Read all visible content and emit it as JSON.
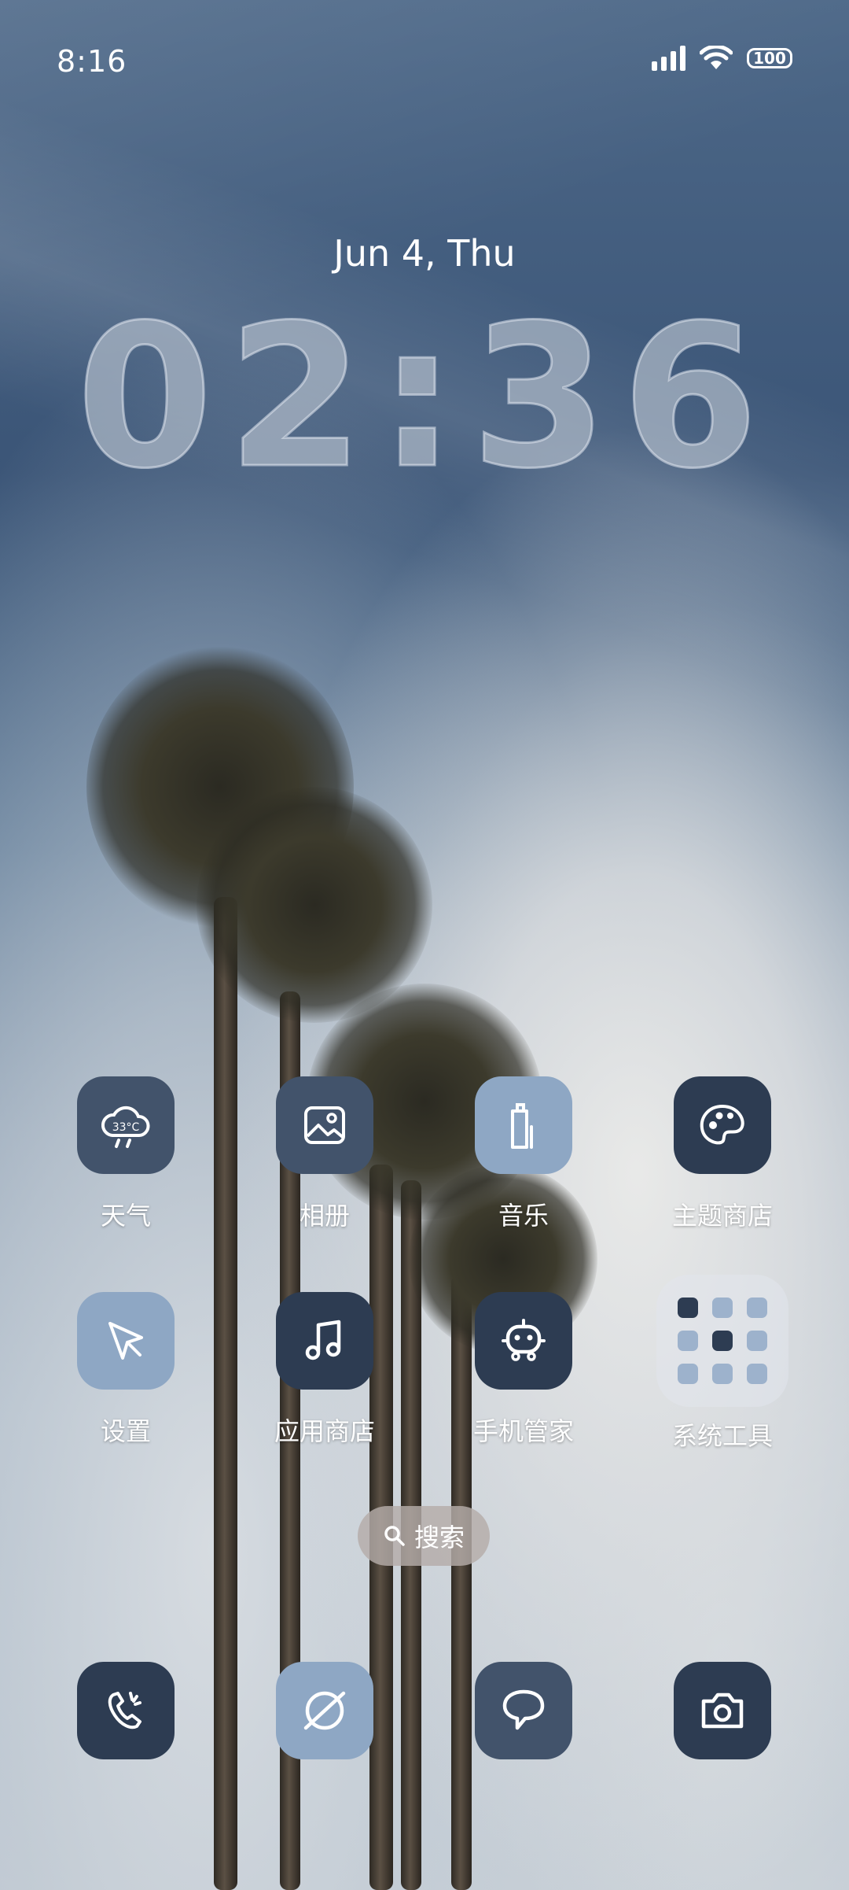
{
  "status_bar": {
    "time": "8:16",
    "battery": "100"
  },
  "lockclock": {
    "date": "Jun 4, Thu",
    "time": "02:36"
  },
  "weather_temp": "33°C",
  "apps_row1": [
    {
      "label": "天气",
      "icon": "weather-icon"
    },
    {
      "label": "相册",
      "icon": "gallery-icon"
    },
    {
      "label": "音乐",
      "icon": "music-bag-icon"
    },
    {
      "label": "主题商店",
      "icon": "palette-icon"
    }
  ],
  "apps_row2": [
    {
      "label": "设置",
      "icon": "cursor-icon"
    },
    {
      "label": "应用商店",
      "icon": "music-note-icon"
    },
    {
      "label": "手机管家",
      "icon": "robot-icon"
    },
    {
      "label": "系统工具",
      "icon": "folder-icon"
    }
  ],
  "search": {
    "label": "搜索"
  },
  "dock": [
    {
      "icon": "phone-icon"
    },
    {
      "icon": "browser-icon"
    },
    {
      "icon": "message-icon"
    },
    {
      "icon": "camera-icon"
    }
  ],
  "colors": {
    "tile_dark": "#2d3c52",
    "tile_mid": "#42536b",
    "tile_light": "#8ea7c4"
  }
}
